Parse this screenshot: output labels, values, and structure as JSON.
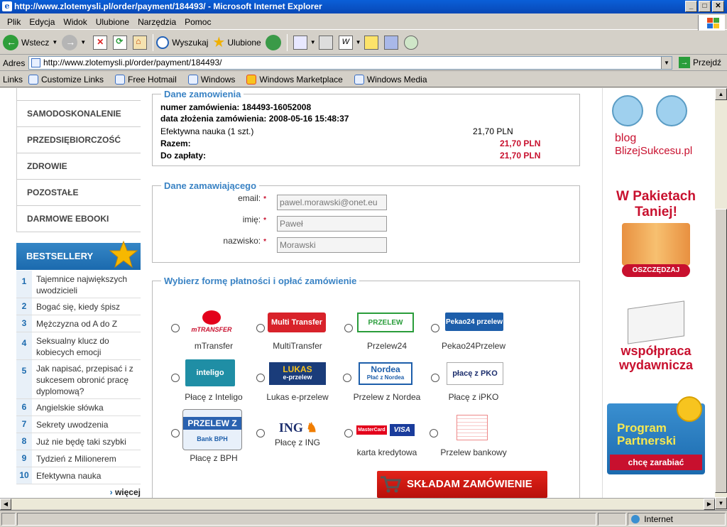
{
  "window": {
    "title": "http://www.zlotemysli.pl/order/payment/184493/ - Microsoft Internet Explorer"
  },
  "menu": [
    "Plik",
    "Edycja",
    "Widok",
    "Ulubione",
    "Narzędzia",
    "Pomoc"
  ],
  "toolbar": {
    "back": "Wstecz",
    "search": "Wyszukaj",
    "favorites": "Ulubione"
  },
  "address": {
    "label": "Adres",
    "url": "http://www.zlotemysli.pl/order/payment/184493/",
    "go": "Przejdź"
  },
  "links": {
    "label": "Links",
    "items": [
      "Customize Links",
      "Free Hotmail",
      "Windows",
      "Windows Marketplace",
      "Windows Media"
    ]
  },
  "nav": {
    "categories": [
      "SAMODOSKONALENIE",
      "PRZEDSIĘBIORCZOŚĆ",
      "ZDROWIE",
      "POZOSTAŁE",
      "DARMOWE EBOOKI"
    ],
    "bestsellers_title": "BESTSELLERY",
    "bestsellers": [
      {
        "n": "1",
        "t": "Tajemnice największych uwodzicieli"
      },
      {
        "n": "2",
        "t": "Bogać się, kiedy śpisz"
      },
      {
        "n": "3",
        "t": "Mężczyzna od A do Z"
      },
      {
        "n": "4",
        "t": "Seksualny klucz do kobiecych emocji"
      },
      {
        "n": "5",
        "t": "Jak napisać, przepisać i z sukcesem obronić pracę dyplomową?"
      },
      {
        "n": "6",
        "t": "Angielskie słówka"
      },
      {
        "n": "7",
        "t": "Sekrety uwodzenia"
      },
      {
        "n": "8",
        "t": "Już nie będę taki szybki"
      },
      {
        "n": "9",
        "t": "Tydzień z Milionerem"
      },
      {
        "n": "10",
        "t": "Efektywna nauka"
      }
    ],
    "more": "więcej"
  },
  "order": {
    "title": "Dane zamowienia",
    "number_line": "numer zamówienia: 184493-16052008",
    "date_line": "data złożenia zamówienia: 2008-05-16 15:48:37",
    "item": "Efektywna nauka (1 szt.)",
    "item_price": "21,70 PLN",
    "total_label": "Razem:",
    "total": "21,70 PLN",
    "due_label": "Do zapłaty:",
    "due": "21,70 PLN"
  },
  "customer": {
    "title": "Dane zamawiającego",
    "email_label": "email:",
    "email": "pawel.morawski@onet.eu",
    "name_label": "imię:",
    "name": "Paweł",
    "surname_label": "nazwisko:",
    "surname": "Morawski"
  },
  "payment": {
    "title": "Wybierz formę płatności i opłać zamówienie",
    "methods": [
      "mTransfer",
      "MultiTransfer",
      "Przelew24",
      "Pekao24Przelew",
      "Płacę z Inteligo",
      "Lukas e-przelew",
      "Przelew z Nordea",
      "Płacę z iPKO",
      "Płacę z BPH",
      "Płacę z ING",
      "karta kredytowa",
      "Przelew bankowy"
    ],
    "logos": {
      "multi": "Multi Transfer",
      "przelew24": "PRZELEW",
      "pekao": "Pekao24 przelew",
      "inteligo": "inteligo",
      "lukas": "LUKAS",
      "lukas_sub": "e-przelew",
      "nordea": "Nordea",
      "nordea_sub": "Płać z Nordea",
      "ipko": "płacę z PKO",
      "bph": "PRZELEW Z",
      "bph_sub": "Bank BPH",
      "ing": "ING",
      "mtransfer": "mTRANSFER",
      "mastercard": "MasterCard",
      "visa": "VISA"
    },
    "submit": "SKŁADAM ZAMÓWIENIE"
  },
  "sidebar": {
    "blog1": "blog",
    "blog2": "BlizejSukcesu.pl",
    "pakiet1": "W Pakietach",
    "pakiet2": "Taniej!",
    "pakiet_btn": "OSZCZĘDZAJ",
    "wsp1": "współpraca",
    "wsp2": "wydawnicza",
    "prog1": "Program",
    "prog2": "Partnerski",
    "prog_btn": "chcę zarabiać"
  },
  "status": {
    "zone": "Internet"
  }
}
